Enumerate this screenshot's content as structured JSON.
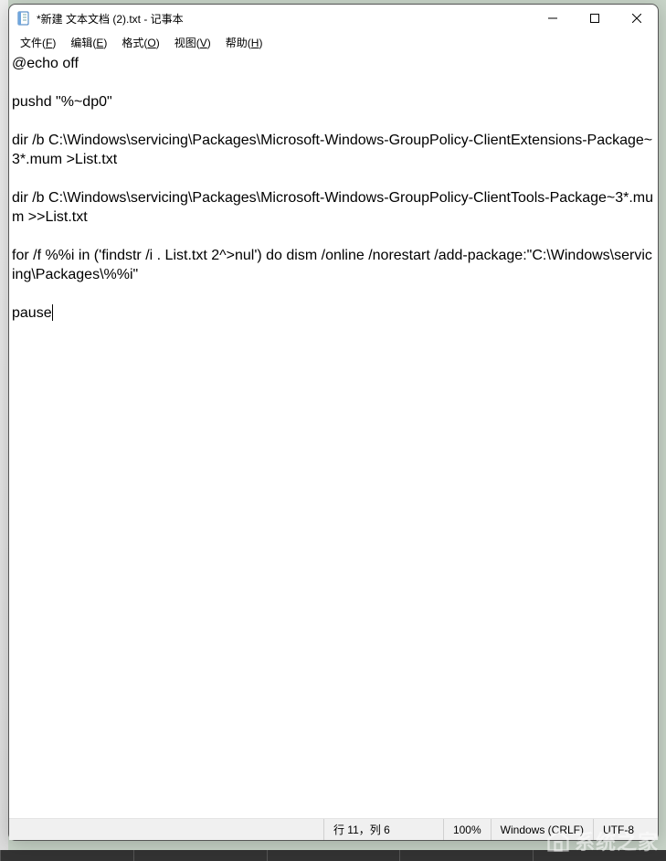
{
  "window": {
    "title": "*新建 文本文档 (2).txt - 记事本"
  },
  "menu": {
    "file": {
      "label": "文件",
      "key": "F"
    },
    "edit": {
      "label": "编辑",
      "key": "E"
    },
    "format": {
      "label": "格式",
      "key": "O"
    },
    "view": {
      "label": "视图",
      "key": "V"
    },
    "help": {
      "label": "帮助",
      "key": "H"
    }
  },
  "editor": {
    "content": "@echo off\n\npushd \"%~dp0\"\n\ndir /b C:\\Windows\\servicing\\Packages\\Microsoft-Windows-GroupPolicy-ClientExtensions-Package~3*.mum >List.txt\n\ndir /b C:\\Windows\\servicing\\Packages\\Microsoft-Windows-GroupPolicy-ClientTools-Package~3*.mum >>List.txt\n\nfor /f %%i in ('findstr /i . List.txt 2^>nul') do dism /online /norestart /add-package:\"C:\\Windows\\servicing\\Packages\\%%i\"\n\npause"
  },
  "status": {
    "position": "行 11，列 6",
    "zoom": "100%",
    "lineending": "Windows (CRLF)",
    "encoding": "UTF-8"
  },
  "watermark": {
    "text": "系统之家"
  }
}
